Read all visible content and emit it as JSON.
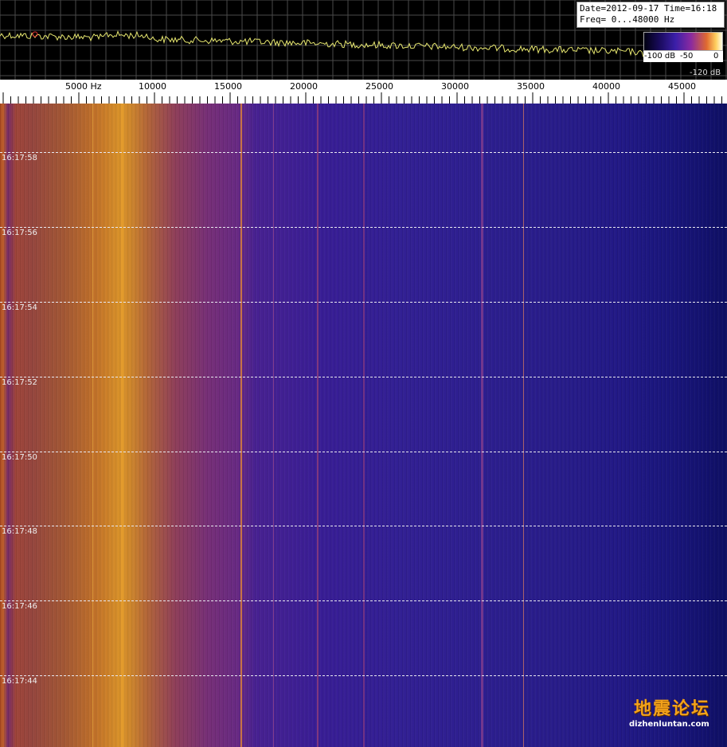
{
  "info": {
    "date_time": "Date=2012-09-17 Time=16:18",
    "freq_range": "Freq= 0...48000 Hz"
  },
  "colorbar": {
    "labels": [
      "-100 dB",
      "-50",
      "0"
    ]
  },
  "db_low": "-120 dB",
  "freq_axis": {
    "labels": [
      "5000 Hz",
      "10000",
      "15000",
      "20000",
      "25000",
      "30000",
      "35000",
      "40000",
      "45000"
    ]
  },
  "time_labels": [
    "16:17:58",
    "16:17:56",
    "16:17:54",
    "16:17:52",
    "16:17:50",
    "16:17:48",
    "16:17:46",
    "16:17:44"
  ],
  "watermark": {
    "title": "地震论坛",
    "url": "dizhenluntan.com"
  },
  "colors": {
    "spectrum_trace": "#e8e870",
    "grid": "#5a5a5a",
    "hot": "#e0962a",
    "cold": "#0e0f66"
  }
}
